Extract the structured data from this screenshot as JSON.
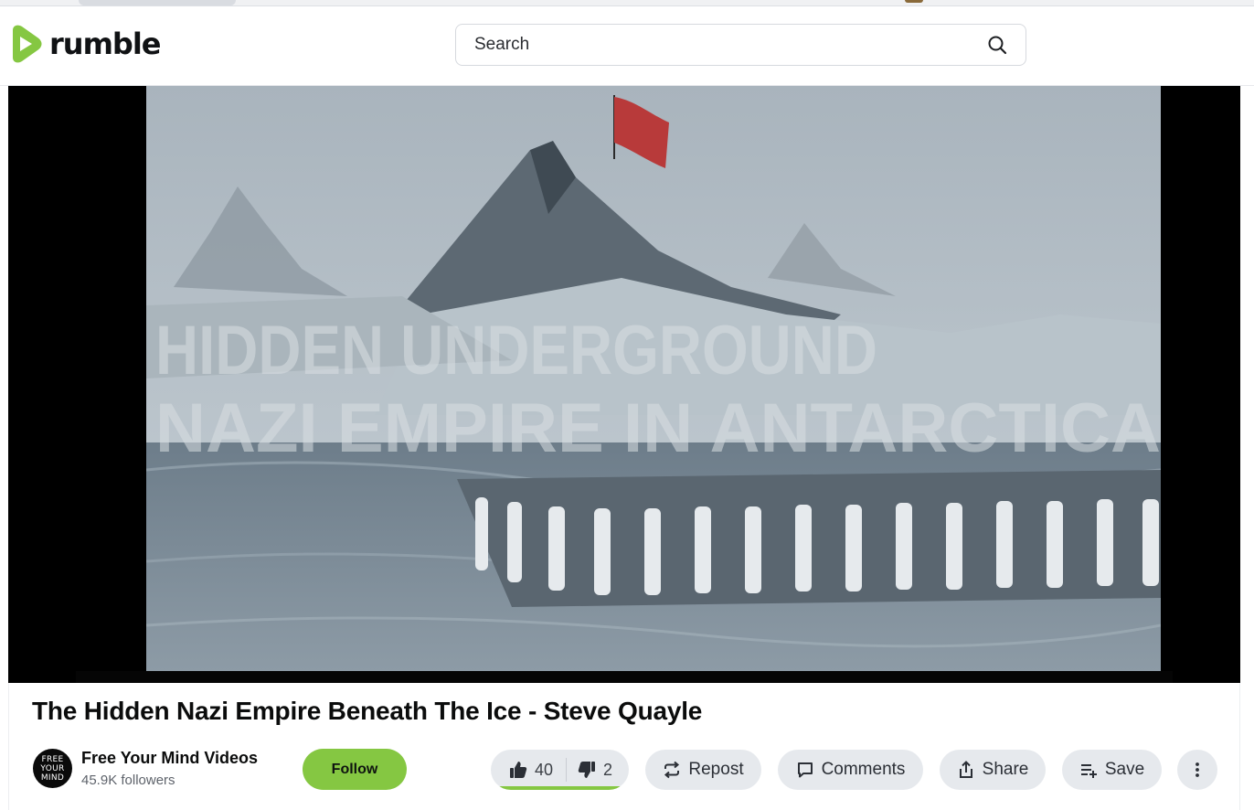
{
  "site": {
    "name": "rumble"
  },
  "search": {
    "placeholder": "Search"
  },
  "video": {
    "title": "The Hidden Nazi Empire Beneath The Ice - Steve Quayle",
    "overlay_line1": "HIDDEN UNDERGROUND",
    "overlay_line2": "NAZI EMPIRE IN ANTARCTICA"
  },
  "channel": {
    "name": "Free Your Mind Videos",
    "followers": "45.9K followers",
    "avatar_text_1": "FREE",
    "avatar_text_2": "YOUR",
    "avatar_text_3": "MIND",
    "follow_label": "Follow"
  },
  "actions": {
    "likes": "40",
    "dislikes": "2",
    "like_ratio": 0.95,
    "repost_label": "Repost",
    "comments_label": "Comments",
    "share_label": "Share",
    "save_label": "Save"
  },
  "colors": {
    "brand_green": "#85c742",
    "pill_bg": "#e6e9ed"
  }
}
